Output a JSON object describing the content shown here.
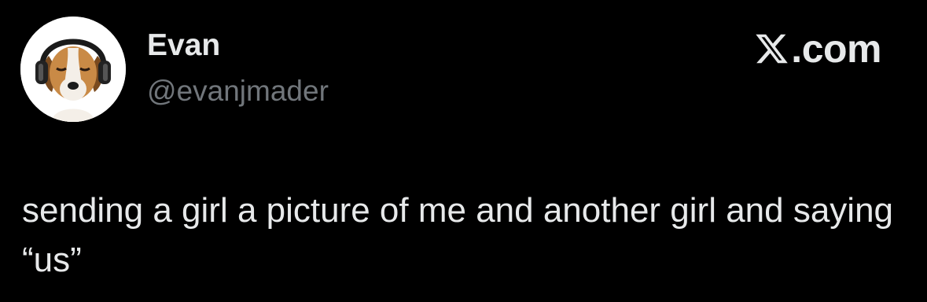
{
  "tweet": {
    "author": {
      "display_name": "Evan",
      "handle": "@evanjmader",
      "avatar_icon": "dog-with-headphones-avatar"
    },
    "brand": {
      "icon": "x-logo-icon",
      "label": ".com"
    },
    "text": "sending a girl a picture of me and another girl and saying “us”"
  },
  "colors": {
    "background": "#000000",
    "primary_text": "#e7e9ea",
    "secondary_text": "#71767b"
  }
}
